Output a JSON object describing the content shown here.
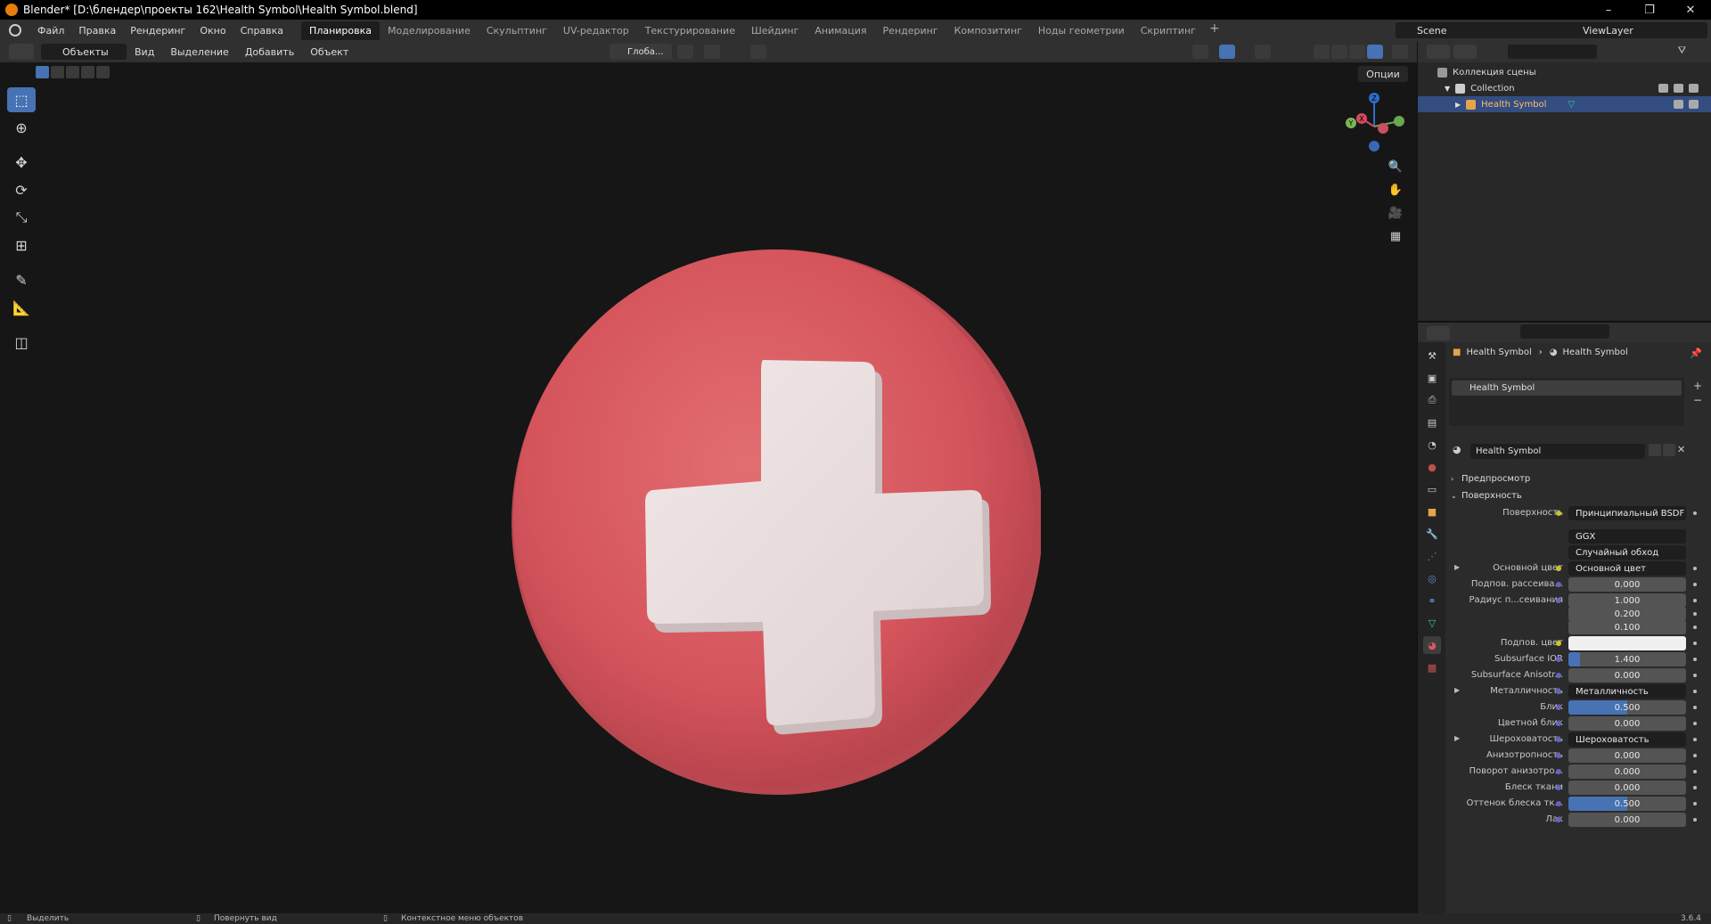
{
  "window": {
    "title": "Blender* [D:\\блендер\\проекты 162\\Health Symbol\\Health Symbol.blend]",
    "minimize": "–",
    "maximize": "❐",
    "close": "✕"
  },
  "menu": [
    "Файл",
    "Правка",
    "Рендеринг",
    "Окно",
    "Справка"
  ],
  "workspaces": [
    "Планировка",
    "Моделирование",
    "Скульптинг",
    "UV-редактор",
    "Текстурирование",
    "Шейдинг",
    "Анимация",
    "Рендеринг",
    "Композитинг",
    "Ноды геометрии",
    "Скриптинг"
  ],
  "workspace_add": "+",
  "scene": "Scene",
  "view_layer": "ViewLayer",
  "viewport_header": {
    "mode": "Объекты",
    "menus": [
      "Вид",
      "Выделение",
      "Добавить",
      "Объект"
    ],
    "transform": "Глоба...",
    "options": "Опции"
  },
  "tools": [
    "select-box",
    "cursor",
    "move",
    "rotate",
    "scale",
    "transform",
    "annotate",
    "measure",
    "add-cube"
  ],
  "gizmo": {
    "x": "X",
    "y": "Y",
    "z": "Z"
  },
  "outliner": {
    "root": "Коллекция сцены",
    "collection": "Collection",
    "object": "Health Symbol"
  },
  "properties": {
    "breadcrumb_object": "Health Symbol",
    "breadcrumb_material": "Health Symbol",
    "slot": "Health Symbol",
    "material_name": "Health Symbol",
    "panel_preview": "Предпросмотр",
    "panel_surface": "Поверхность",
    "rows": [
      {
        "label": "Поверхность",
        "value": "Принципиальный BSDF",
        "kind": "dark",
        "sock": "y"
      },
      {
        "label": "",
        "value": "GGX",
        "kind": "dark",
        "sock": ""
      },
      {
        "label": "",
        "value": "Случайный обход",
        "kind": "dark",
        "sock": ""
      },
      {
        "label": "Основной цвет",
        "value": "Основной цвет",
        "kind": "dark",
        "sock": "y",
        "expand": true
      },
      {
        "label": "Подпов. рассеива...",
        "value": "0.000",
        "kind": "num",
        "sock": "b",
        "fill": 0
      },
      {
        "label": "Радиус п...сеивания",
        "value": "1.000",
        "kind": "num",
        "sock": "b",
        "fill": 0
      },
      {
        "label": "",
        "value": "0.200",
        "kind": "num",
        "sock": "",
        "fill": 0
      },
      {
        "label": "",
        "value": "0.100",
        "kind": "num",
        "sock": "",
        "fill": 0
      },
      {
        "label": "Подпов. цвет",
        "value": "",
        "kind": "white",
        "sock": "y"
      },
      {
        "label": "Subsurface IOR",
        "value": "1.400",
        "kind": "num",
        "sock": "b",
        "fill": 0.1
      },
      {
        "label": "Subsurface Anisotr...",
        "value": "0.000",
        "kind": "num",
        "sock": "b",
        "fill": 0
      },
      {
        "label": "Металличность",
        "value": "Металличность",
        "kind": "dark",
        "sock": "b",
        "expand": true
      },
      {
        "label": "Блик",
        "value": "0.500",
        "kind": "num",
        "sock": "b",
        "fill": 0.5
      },
      {
        "label": "Цветной блик",
        "value": "0.000",
        "kind": "num",
        "sock": "b",
        "fill": 0
      },
      {
        "label": "Шероховатость",
        "value": "Шероховатость",
        "kind": "dark",
        "sock": "b",
        "expand": true
      },
      {
        "label": "Анизотропность",
        "value": "0.000",
        "kind": "num",
        "sock": "b",
        "fill": 0
      },
      {
        "label": "Поворот анизотро...",
        "value": "0.000",
        "kind": "num",
        "sock": "b",
        "fill": 0
      },
      {
        "label": "Блеск ткани",
        "value": "0.000",
        "kind": "num",
        "sock": "b",
        "fill": 0
      },
      {
        "label": "Оттенок блеска тк...",
        "value": "0.500",
        "kind": "num",
        "sock": "b",
        "fill": 0.5
      },
      {
        "label": "Лак",
        "value": "0.000",
        "kind": "num",
        "sock": "b",
        "fill": 0
      }
    ]
  },
  "status": {
    "select": "Выделить",
    "rotate_view": "Повернуть вид",
    "context_menu": "Контекстное меню объектов",
    "version": "3.6.4"
  },
  "colors": {
    "accent": "#4772b3",
    "disc": "#d9575f",
    "cross": "#e9dede"
  }
}
